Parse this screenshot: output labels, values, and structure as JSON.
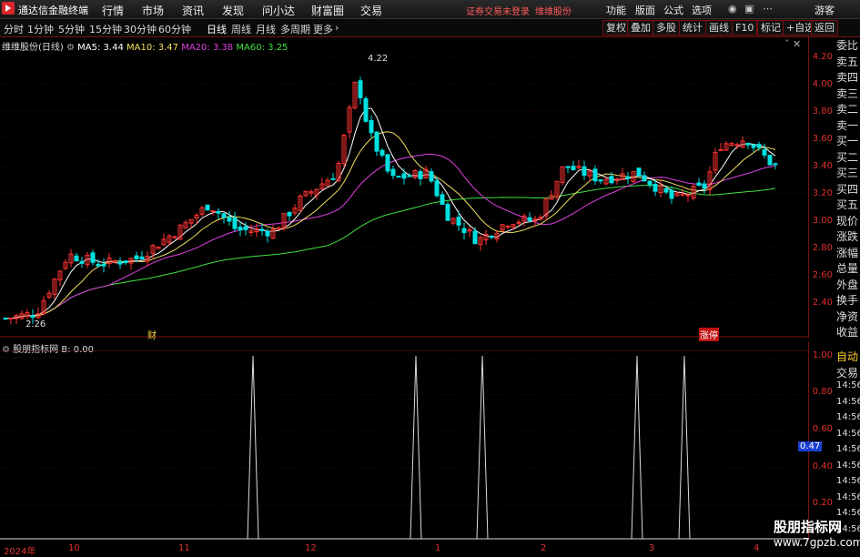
{
  "app": {
    "title": "通达信金融终端"
  },
  "menu": [
    "行情",
    "市场",
    "资讯",
    "发现",
    "问小达",
    "财富圈",
    "交易"
  ],
  "login_warning": "证券交易未登录",
  "stock_name": "维维股份",
  "right_menu": [
    "功能",
    "版面",
    "公式",
    "选项"
  ],
  "guest": "游客",
  "periods": [
    "分时",
    "1分钟",
    "5分钟",
    "15分钟",
    "30分钟",
    "60分钟",
    "日线",
    "周线",
    "月线",
    "多周期",
    "更多"
  ],
  "active_period": "日线",
  "tools": [
    "复权",
    "叠加",
    "多股",
    "统计",
    "画线",
    "F10",
    "标记",
    "+自选",
    "返回"
  ],
  "main": {
    "title": "维维股份(日线)",
    "ma": [
      {
        "label": "MA5: 3.44",
        "color": "#ffffff"
      },
      {
        "label": "MA10: 3.47",
        "color": "#f0e060"
      },
      {
        "label": "MA20: 3.38",
        "color": "#e040e0"
      },
      {
        "label": "MA60: 3.25",
        "color": "#40e040"
      }
    ],
    "high_label": "4.22",
    "low_label": "2.26",
    "marker1": "财",
    "marker2": "涨停",
    "yticks": [
      "4.20",
      "4.00",
      "3.80",
      "3.60",
      "3.40",
      "3.20",
      "3.00",
      "2.80",
      "2.60",
      "2.40"
    ]
  },
  "side": [
    "委比",
    "卖五",
    "卖四",
    "卖三",
    "卖二",
    "卖一",
    "买一",
    "买二",
    "买三",
    "买四",
    "买五",
    "现价",
    "涨跌",
    "涨幅",
    "总量",
    "外盘",
    "换手",
    "净资",
    "收益"
  ],
  "sub": {
    "title": "股朋指标网",
    "value": "B: 0.00",
    "yticks": [
      "1.00",
      "0.80",
      "0.60",
      "0.40",
      "0.20"
    ],
    "current": "0.47",
    "side": [
      "自动",
      "交易",
      "14:56",
      "14:56",
      "14:56",
      "14:56",
      "14:56",
      "14:56",
      "14:56",
      "14:56",
      "14:56",
      "14:56"
    ]
  },
  "xaxis": [
    "2024年",
    "10",
    "11",
    "12",
    "1",
    "2",
    "3",
    "4"
  ],
  "watermark": {
    "line1": "股朋指标网",
    "line2": "www.7gpzb.com"
  },
  "colors": {
    "up": "#ff3232",
    "down": "#00e0e0",
    "grid": "#7a1010"
  }
}
